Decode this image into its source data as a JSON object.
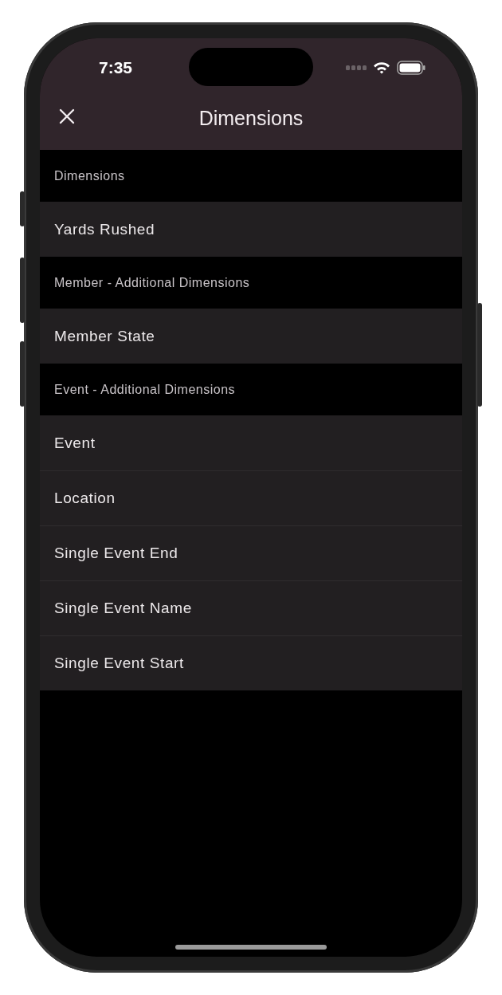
{
  "status_bar": {
    "time": "7:35"
  },
  "header": {
    "title": "Dimensions"
  },
  "sections": [
    {
      "title": "Dimensions",
      "items": [
        "Yards Rushed"
      ]
    },
    {
      "title": "Member - Additional Dimensions",
      "items": [
        "Member State"
      ]
    },
    {
      "title": "Event - Additional Dimensions",
      "items": [
        "Event",
        "Location",
        "Single Event End",
        "Single Event Name",
        "Single Event Start"
      ]
    }
  ]
}
